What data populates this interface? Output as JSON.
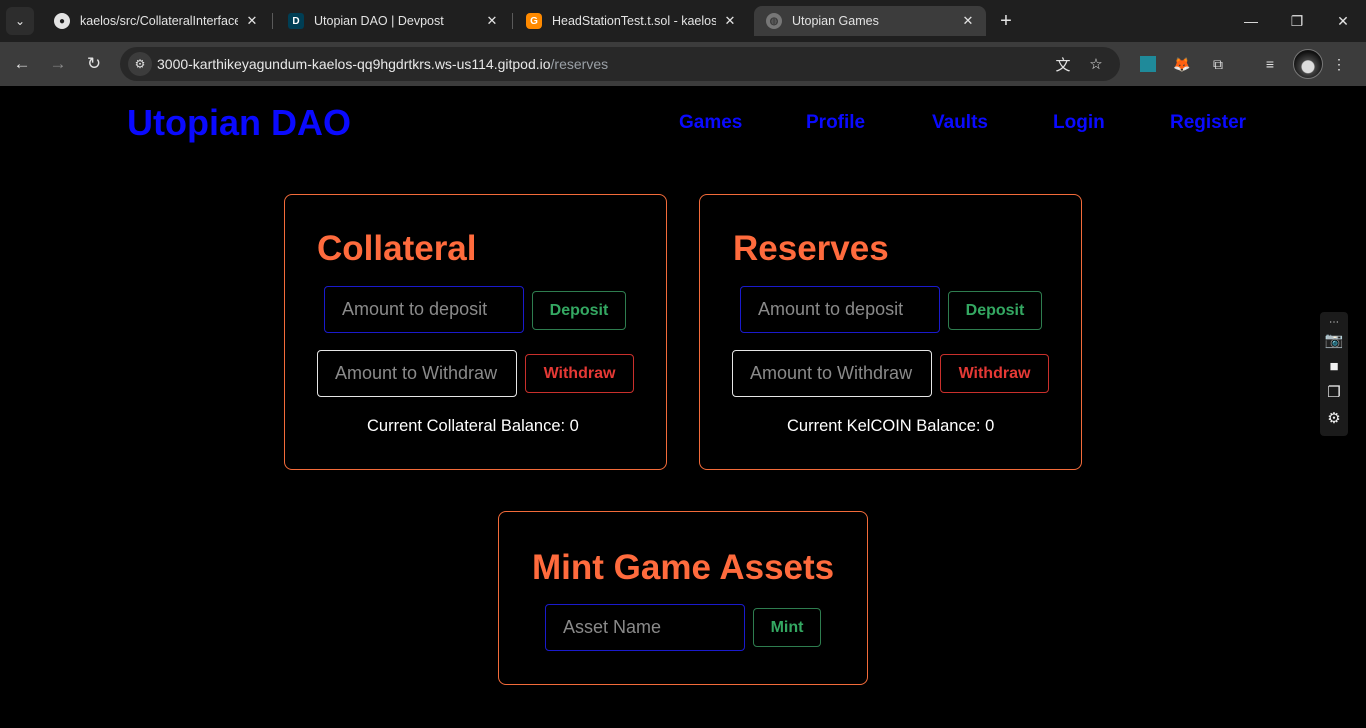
{
  "browser": {
    "tabs": [
      {
        "label": "kaelos/src/CollateralInterface.so",
        "icon": "github-icon"
      },
      {
        "label": "Utopian DAO | Devpost",
        "icon": "devpost-icon"
      },
      {
        "label": "HeadStationTest.t.sol - kaelos - ",
        "icon": "gitpod-icon"
      },
      {
        "label": "Utopian Games",
        "icon": "globe-icon"
      }
    ],
    "url_host": "3000-karthikeyagundum-kaelos-qq9hgdrtkrs.ws-us114.gitpod.io",
    "url_path": "/reserves"
  },
  "header": {
    "brand": "Utopian DAO",
    "nav": [
      "Games",
      "Profile",
      "Vaults",
      "Login",
      "Register"
    ]
  },
  "collateral": {
    "title": "Collateral",
    "deposit_placeholder": "Amount to deposit",
    "deposit_button": "Deposit",
    "withdraw_placeholder": "Amount to Withdraw",
    "withdraw_button": "Withdraw",
    "balance": "Current Collateral Balance: 0"
  },
  "reserves": {
    "title": "Reserves",
    "deposit_placeholder": "Amount to deposit",
    "deposit_button": "Deposit",
    "withdraw_placeholder": "Amount to Withdraw",
    "withdraw_button": "Withdraw",
    "balance": "Current KelCOIN Balance: 0"
  },
  "mint": {
    "title": "Mint Game Assets",
    "asset_placeholder": "Asset Name",
    "mint_button": "Mint"
  },
  "colors": {
    "brand_blue": "#0a0aff",
    "title_orange": "#ff6b3d",
    "button_green": "#34a862",
    "button_red": "#e53935"
  }
}
